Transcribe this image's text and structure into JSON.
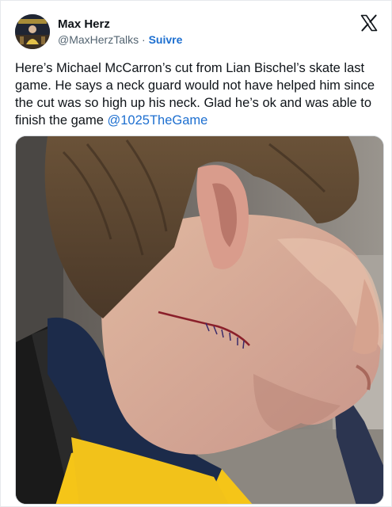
{
  "author": {
    "display_name": "Max Herz",
    "handle": "@MaxHerzTalks",
    "separator": " · ",
    "follow_label": "Suivre"
  },
  "tweet": {
    "text_before_mention": "Here’s Michael McCarron’s cut from Lian Bischel’s skate last game. He says a neck guard would not have helped him since the cut was so high up his neck. Glad he’s ok and was able to finish the game ",
    "mention": "@1025TheGame"
  },
  "icons": {
    "platform_logo": "x-logo-icon"
  },
  "colors": {
    "link": "#1d6fd0",
    "text": "#0f1419",
    "secondary_text": "#536471",
    "jersey": "#f5c518",
    "jersey_collar": "#1c2b4a"
  }
}
